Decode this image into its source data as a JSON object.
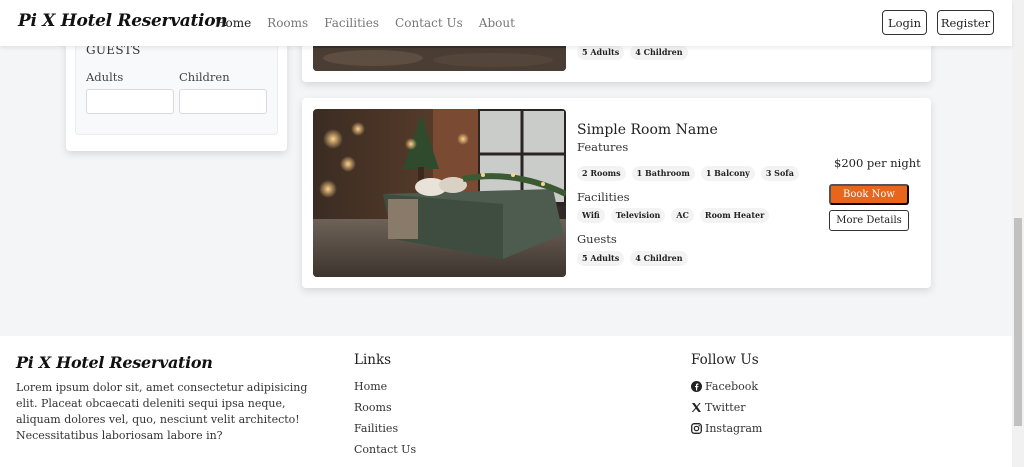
{
  "navbar": {
    "brand": "Pi X Hotel Reservation",
    "links": [
      "Home",
      "Rooms",
      "Facilities",
      "Contact Us",
      "About"
    ],
    "active": "Home",
    "login_label": "Login",
    "register_label": "Register"
  },
  "filters": {
    "guests_title": "GUESTS",
    "adults_label": "Adults",
    "children_label": "Children",
    "adults_value": "",
    "children_value": ""
  },
  "room_top": {
    "guests": [
      "5 Adults",
      "4 Children"
    ]
  },
  "room": {
    "name": "Simple Room Name",
    "features_label": "Features",
    "features": [
      "2 Rooms",
      "1 Bathroom",
      "1 Balcony",
      "3 Sofa"
    ],
    "facilities_label": "Facilities",
    "facilities": [
      "Wifi",
      "Television",
      "AC",
      "Room Heater"
    ],
    "guests_label": "Guests",
    "guests": [
      "5 Adults",
      "4 Children"
    ],
    "price": "$200 per night",
    "book_label": "Book Now",
    "details_label": "More Details"
  },
  "footer": {
    "brand": "Pi X Hotel Reservation",
    "description": "Lorem ipsum dolor sit, amet consectetur adipisicing elit. Placeat obcaecati deleniti sequi ipsa neque, aliquam dolores vel, quo, nesciunt velit architecto! Necessitatibus laboriosam labore in?",
    "links_title": "Links",
    "links": [
      "Home",
      "Rooms",
      "Failities",
      "Contact Us"
    ],
    "follow_title": "Follow Us",
    "social": [
      "Facebook",
      "Twitter",
      "Instagram"
    ]
  },
  "colors": {
    "accent": "#e8661c",
    "background": "#f4f5f7"
  }
}
